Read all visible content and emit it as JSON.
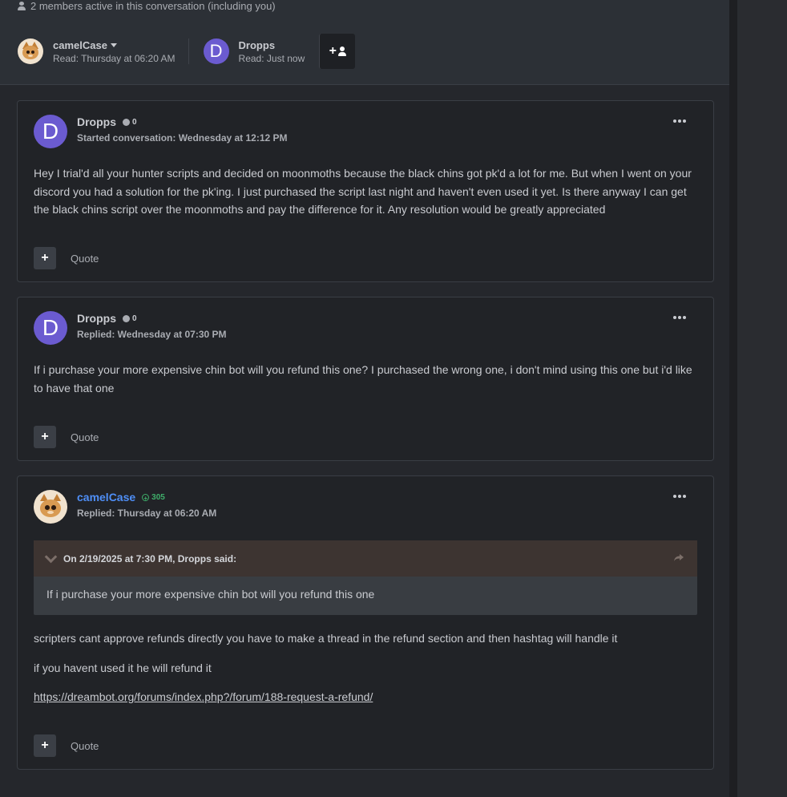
{
  "header": {
    "members_active": "2 members active in this conversation (including you)",
    "participants": [
      {
        "name": "camelCase",
        "read": "Read: Thursday at 06:20 AM",
        "avatar": "camel-avatar"
      },
      {
        "name": "Dropps",
        "read": "Read: Just now",
        "avatar": "D"
      }
    ],
    "add_participant_icon": "add-user-icon"
  },
  "posts": [
    {
      "author": "Dropps",
      "avatar": "D",
      "reputation": "0",
      "meta": "Started conversation: Wednesday at 12:12 PM",
      "body": "Hey I trial'd all your hunter scripts and decided on moonmoths because the black chins got pk'd a lot for me. But when I went on your discord you had a solution for the pk'ing. I just purchased the script last night and haven't even used it yet. Is there anyway I can get the black chins script over the moonmoths and pay the difference for it. Any resolution would be greatly appreciated",
      "quote_label": "Quote"
    },
    {
      "author": "Dropps",
      "avatar": "D",
      "reputation": "0",
      "meta": "Replied: Wednesday at 07:30 PM",
      "body": "If i purchase your more expensive chin bot will you refund this one? I purchased the wrong one, i don't mind using this one but i'd like to have that one",
      "quote_label": "Quote"
    },
    {
      "author": "camelCase",
      "avatar": "camel-avatar",
      "reputation": "305",
      "meta": "Replied: Thursday at 06:20 AM",
      "quote": {
        "citation": "On 2/19/2025 at 7:30 PM, Dropps said:",
        "text": "If i purchase your more expensive chin bot will you refund this one"
      },
      "paragraph1": "scripters cant approve refunds directly you have to make a thread in the refund section and then hashtag will handle it",
      "paragraph2": "if you havent used it he will refund it",
      "link": "https://dreambot.org/forums/index.php?/forum/188-request-a-refund/",
      "quote_label": "Quote"
    }
  ],
  "colors": {
    "accent_blue": "#4f8ff7",
    "reputation_green": "#3fae6a",
    "avatar_purple": "#6b5bd0"
  }
}
